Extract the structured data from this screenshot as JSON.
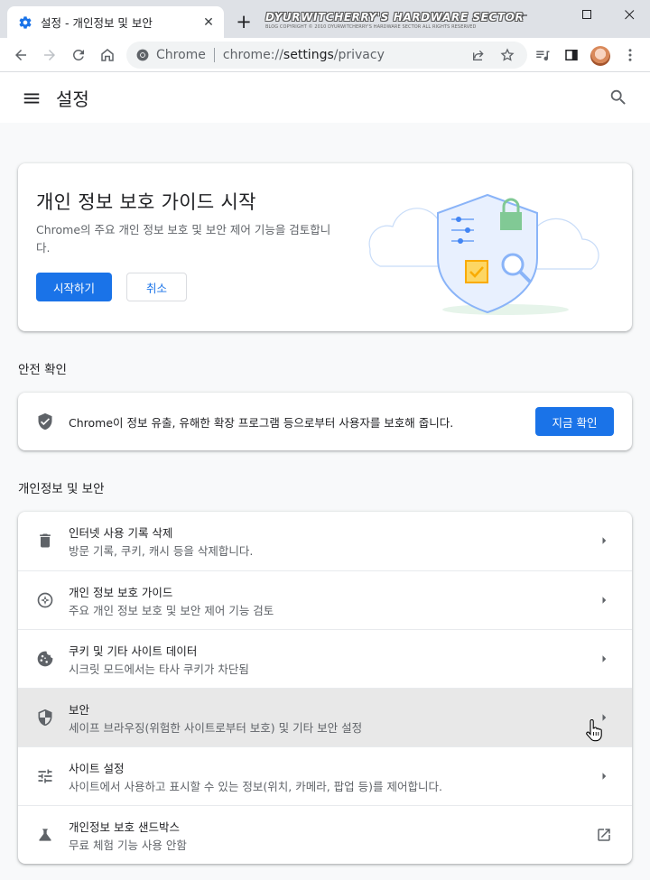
{
  "browser": {
    "tab_title": "설정 - 개인정보 및 보안",
    "tab_close": "✕",
    "new_tab": "+",
    "watermark_title": "DYURWITCHERRY'S HARDWARE SECTOR",
    "watermark_sub": "BLOG COPYRIGHT © 2010 DYURWITCHERRY'S HARDWARE SECTOR ALL RIGHTS RESERVED",
    "site_name": "Chrome",
    "url_scheme": "chrome://",
    "url_host": "settings",
    "url_path": "/privacy",
    "window_controls": {
      "minimize": "—",
      "maximize": "☐",
      "close": "✕"
    }
  },
  "settings": {
    "title": "설정"
  },
  "promo": {
    "title": "개인 정보 보호 가이드 시작",
    "description": "Chrome의 주요 개인 정보 보호 및 보안 제어 기능을 검토합니다.",
    "start_button": "시작하기",
    "cancel_button": "취소"
  },
  "safety_check": {
    "section_title": "안전 확인",
    "text": "Chrome이 정보 유출, 유해한 확장 프로그램 등으로부터 사용자를 보호해 줍니다.",
    "button": "지금 확인"
  },
  "privacy": {
    "section_title": "개인정보 및 보안",
    "rows": [
      {
        "label": "인터넷 사용 기록 삭제",
        "sub": "방문 기록, 쿠키, 캐시 등을 삭제합니다.",
        "icon": "trash-icon"
      },
      {
        "label": "개인 정보 보호 가이드",
        "sub": "주요 개인 정보 보호 및 보안 제어 기능 검토",
        "icon": "compass-icon"
      },
      {
        "label": "쿠키 및 기타 사이트 데이터",
        "sub": "시크릿 모드에서는 타사 쿠키가 차단됨",
        "icon": "cookie-icon"
      },
      {
        "label": "보안",
        "sub": "세이프 브라우징(위험한 사이트로부터 보호) 및 기타 보안 설정",
        "icon": "shield-icon"
      },
      {
        "label": "사이트 설정",
        "sub": "사이트에서 사용하고 표시할 수 있는 정보(위치, 카메라, 팝업 등)를 제어합니다.",
        "icon": "tune-icon"
      },
      {
        "label": "개인정보 보호 샌드박스",
        "sub": "무료 체험 기능 사용 안함",
        "icon": "flask-icon"
      }
    ]
  },
  "colors": {
    "accent": "#1a73e8",
    "hover_row": "#e8e8e8",
    "page_bg": "#f8f9fa"
  }
}
